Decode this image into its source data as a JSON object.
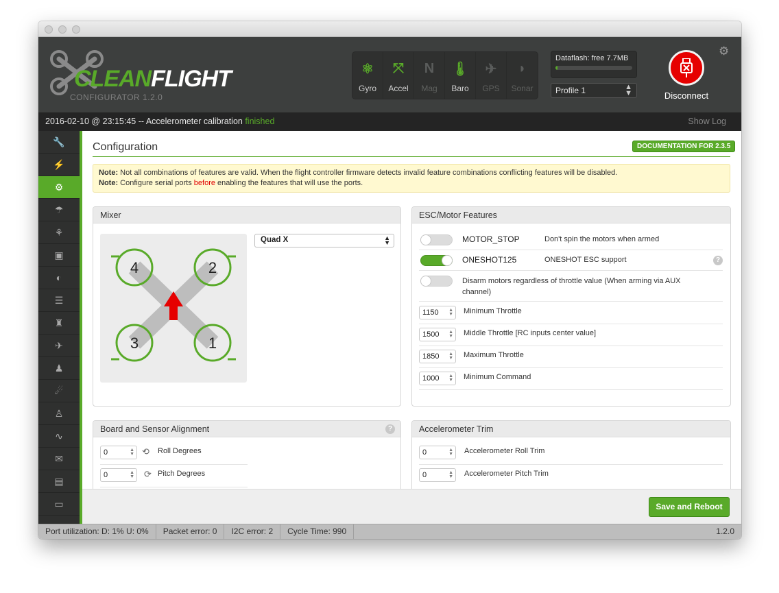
{
  "app": {
    "logo_word_a": "CLEAN",
    "logo_word_b": "FLIGHT",
    "configurator_version": "CONFIGURATOR  1.2.0"
  },
  "sensors": [
    {
      "label": "Gyro",
      "icon": "gyro-icon",
      "active": true
    },
    {
      "label": "Accel",
      "icon": "accel-icon",
      "active": true
    },
    {
      "label": "Mag",
      "icon": "mag-icon",
      "active": false
    },
    {
      "label": "Baro",
      "icon": "baro-icon",
      "active": true
    },
    {
      "label": "GPS",
      "icon": "gps-icon",
      "active": false
    },
    {
      "label": "Sonar",
      "icon": "sonar-icon",
      "active": false
    }
  ],
  "dataflash": {
    "label": "Dataflash: free 7.7MB",
    "used_fraction": 0.03
  },
  "profile": {
    "selected": "Profile 1"
  },
  "disconnect_label": "Disconnect",
  "log": {
    "prefix": "2016-02-10 @ 23:15:45 -- Accelerometer calibration ",
    "status": "finished",
    "show_log": "Show Log"
  },
  "sidebar": [
    {
      "name": "setup",
      "icon": "wrench-icon",
      "glyph": "🔧"
    },
    {
      "name": "ports",
      "icon": "plug-icon",
      "glyph": "⚡"
    },
    {
      "name": "configuration",
      "icon": "gear-icon",
      "glyph": "⚙",
      "active": true
    },
    {
      "name": "failsafe",
      "icon": "parachute-icon",
      "glyph": "☂"
    },
    {
      "name": "pid-tuning",
      "icon": "tree-icon",
      "glyph": "⚘"
    },
    {
      "name": "receiver",
      "icon": "robot-icon",
      "glyph": "▣"
    },
    {
      "name": "modes",
      "icon": "toggle-icon",
      "glyph": "◐"
    },
    {
      "name": "adjustments",
      "icon": "sliders-icon",
      "glyph": "☰"
    },
    {
      "name": "servos",
      "icon": "servo-icon",
      "glyph": "♜"
    },
    {
      "name": "gps",
      "icon": "satellite-icon",
      "glyph": "✈"
    },
    {
      "name": "motors",
      "icon": "motor-icon",
      "glyph": "♟"
    },
    {
      "name": "led-strip",
      "icon": "led-strip-icon",
      "glyph": "☄"
    },
    {
      "name": "sensors",
      "icon": "led-icon",
      "glyph": "♙"
    },
    {
      "name": "tethered-logging",
      "icon": "pulse-icon",
      "glyph": "∿"
    },
    {
      "name": "blackbox",
      "icon": "envelope-icon",
      "glyph": "✉"
    },
    {
      "name": "dataflash",
      "icon": "chip-icon",
      "glyph": "▤"
    },
    {
      "name": "cli",
      "icon": "terminal-icon",
      "glyph": "▭"
    }
  ],
  "page": {
    "title": "Configuration",
    "doc_button": "DOCUMENTATION FOR 2.3.5",
    "note1_bold": "Note:",
    "note1_text": " Not all combinations of features are valid. When the flight controller firmware detects invalid feature combinations conflicting features will be disabled.",
    "note2_bold": "Note:",
    "note2_pre": " Configure serial ports ",
    "note2_red": "before",
    "note2_post": " enabling the features that will use the ports."
  },
  "mixer": {
    "title": "Mixer",
    "selected": "Quad X",
    "motors": [
      "4",
      "2",
      "3",
      "1"
    ]
  },
  "esc": {
    "title": "ESC/Motor Features",
    "features": [
      {
        "name": "MOTOR_STOP",
        "desc": "Don't spin the motors when armed",
        "enabled": false
      },
      {
        "name": "ONESHOT125",
        "desc": "ONESHOT ESC support",
        "enabled": true
      },
      {
        "name": "",
        "desc": "Disarm motors regardless of throttle value (When arming via AUX channel)",
        "enabled": false
      }
    ],
    "throttles": [
      {
        "value": "1150",
        "label": "Minimum Throttle"
      },
      {
        "value": "1500",
        "label": "Middle Throttle [RC inputs center value]"
      },
      {
        "value": "1850",
        "label": "Maximum Throttle"
      },
      {
        "value": "1000",
        "label": "Minimum Command"
      }
    ]
  },
  "board": {
    "title": "Board and Sensor Alignment",
    "roll_value": "0",
    "roll_label": "Roll Degrees",
    "pitch_value": "0",
    "pitch_label": "Pitch Degrees"
  },
  "acc_trim": {
    "title": "Accelerometer Trim",
    "roll_value": "0",
    "roll_label": "Accelerometer Roll Trim",
    "pitch_value": "0",
    "pitch_label": "Accelerometer Pitch Trim"
  },
  "save_button": "Save and Reboot",
  "status": {
    "port": "Port utilization: D: 1% U: 0%",
    "packet": "Packet error: 0",
    "i2c": "I2C error: 2",
    "cycle": "Cycle Time: 990",
    "version": "1.2.0"
  },
  "colors": {
    "accent": "#59aa29",
    "header": "#3d3f3e",
    "danger": "#e60000"
  }
}
